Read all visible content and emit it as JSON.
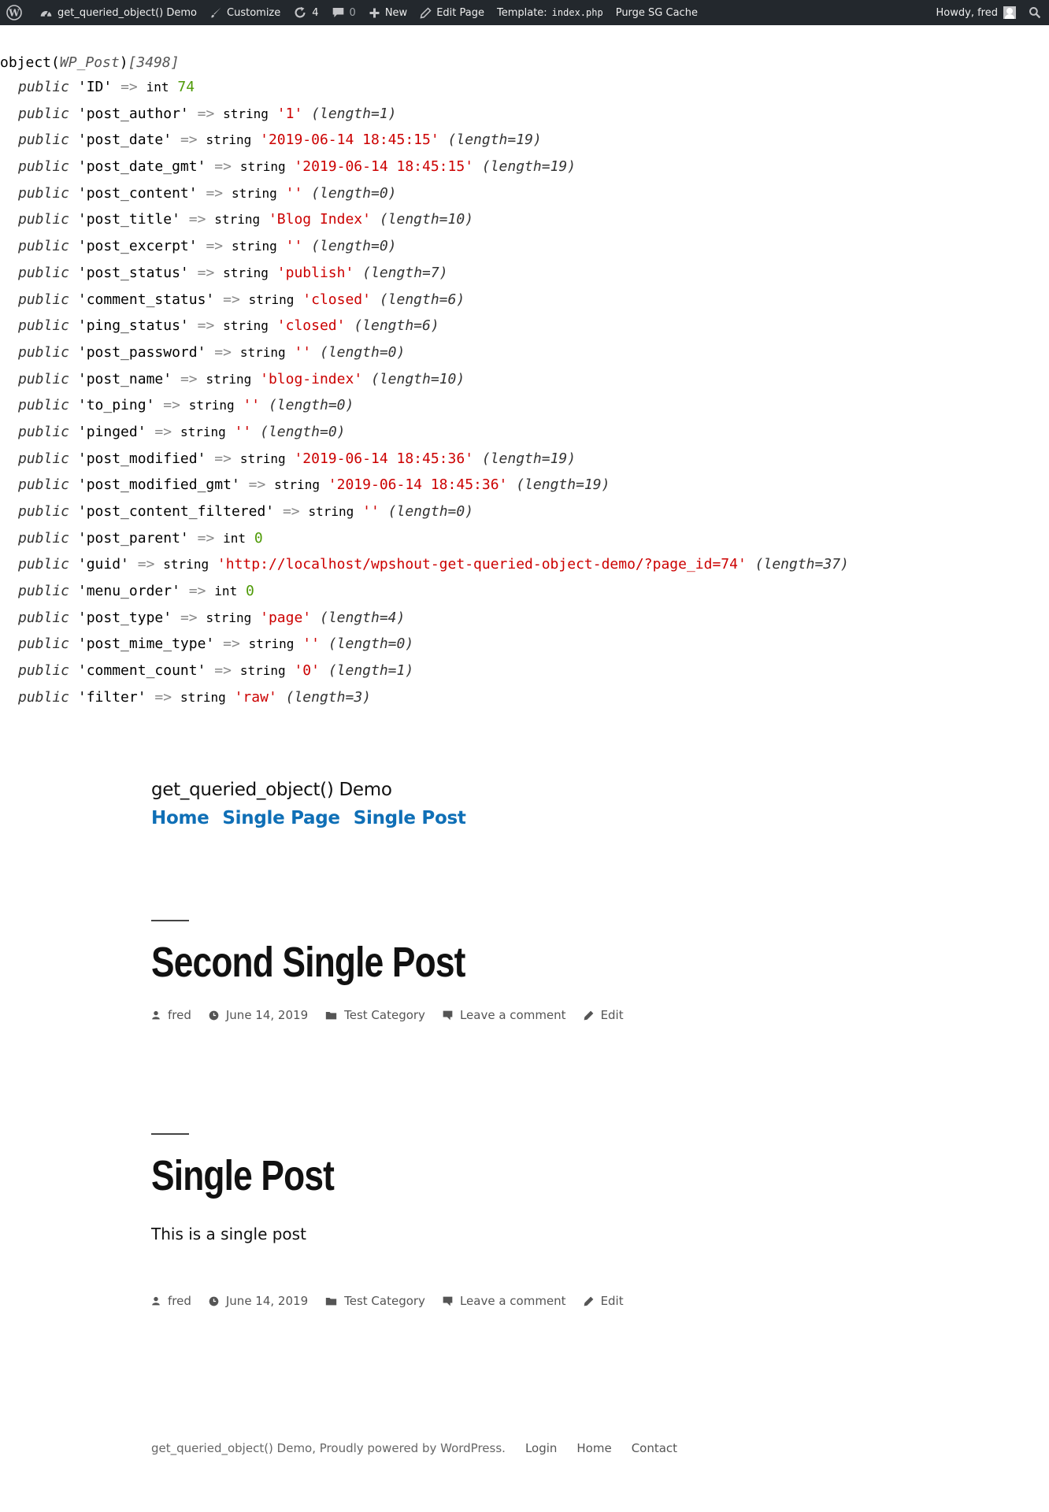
{
  "adminbar": {
    "site_name": "get_queried_object() Demo",
    "customize": "Customize",
    "updates_count": "4",
    "comments_count": "0",
    "new_label": "New",
    "edit_page": "Edit Page",
    "template_label": "Template:",
    "template_file": "index.php",
    "purge_cache": "Purge SG Cache",
    "howdy": "Howdy, fred",
    "colors": {
      "bar_bg": "#23282d",
      "text": "#eeeeee"
    }
  },
  "dump": {
    "object_keyword": "object",
    "class_name": "WP_Post",
    "object_id": "[3498]",
    "properties": [
      {
        "key": "'ID'",
        "type": "int",
        "value": "74",
        "length": ""
      },
      {
        "key": "'post_author'",
        "type": "string",
        "value": "'1'",
        "length": "(length=1)"
      },
      {
        "key": "'post_date'",
        "type": "string",
        "value": "'2019-06-14 18:45:15'",
        "length": "(length=19)"
      },
      {
        "key": "'post_date_gmt'",
        "type": "string",
        "value": "'2019-06-14 18:45:15'",
        "length": "(length=19)"
      },
      {
        "key": "'post_content'",
        "type": "string",
        "value": "''",
        "length": "(length=0)"
      },
      {
        "key": "'post_title'",
        "type": "string",
        "value": "'Blog Index'",
        "length": "(length=10)"
      },
      {
        "key": "'post_excerpt'",
        "type": "string",
        "value": "''",
        "length": "(length=0)"
      },
      {
        "key": "'post_status'",
        "type": "string",
        "value": "'publish'",
        "length": "(length=7)"
      },
      {
        "key": "'comment_status'",
        "type": "string",
        "value": "'closed'",
        "length": "(length=6)"
      },
      {
        "key": "'ping_status'",
        "type": "string",
        "value": "'closed'",
        "length": "(length=6)"
      },
      {
        "key": "'post_password'",
        "type": "string",
        "value": "''",
        "length": "(length=0)"
      },
      {
        "key": "'post_name'",
        "type": "string",
        "value": "'blog-index'",
        "length": "(length=10)"
      },
      {
        "key": "'to_ping'",
        "type": "string",
        "value": "''",
        "length": "(length=0)"
      },
      {
        "key": "'pinged'",
        "type": "string",
        "value": "''",
        "length": "(length=0)"
      },
      {
        "key": "'post_modified'",
        "type": "string",
        "value": "'2019-06-14 18:45:36'",
        "length": "(length=19)"
      },
      {
        "key": "'post_modified_gmt'",
        "type": "string",
        "value": "'2019-06-14 18:45:36'",
        "length": "(length=19)"
      },
      {
        "key": "'post_content_filtered'",
        "type": "string",
        "value": "''",
        "length": "(length=0)"
      },
      {
        "key": "'post_parent'",
        "type": "int",
        "value": "0",
        "length": ""
      },
      {
        "key": "'guid'",
        "type": "string",
        "value": "'http://localhost/wpshout-get-queried-object-demo/?page_id=74'",
        "length": "(length=37)"
      },
      {
        "key": "'menu_order'",
        "type": "int",
        "value": "0",
        "length": ""
      },
      {
        "key": "'post_type'",
        "type": "string",
        "value": "'page'",
        "length": "(length=4)"
      },
      {
        "key": "'post_mime_type'",
        "type": "string",
        "value": "''",
        "length": "(length=0)"
      },
      {
        "key": "'comment_count'",
        "type": "string",
        "value": "'0'",
        "length": "(length=1)"
      },
      {
        "key": "'filter'",
        "type": "string",
        "value": "'raw'",
        "length": "(length=3)"
      }
    ],
    "colors": {
      "string": "#cc0000",
      "int": "#4e9a06"
    }
  },
  "site": {
    "title": "get_queried_object() Demo",
    "nav": [
      "Home",
      "Single Page",
      "Single Post"
    ],
    "link_color": "#0f6fb6"
  },
  "posts": [
    {
      "title": "Second Single Post",
      "excerpt": "",
      "meta": {
        "author": "fred",
        "date": "June 14, 2019",
        "category": "Test Category",
        "comments": "Leave a comment",
        "edit": "Edit"
      }
    },
    {
      "title": "Single Post",
      "excerpt": "This is a single post",
      "meta": {
        "author": "fred",
        "date": "June 14, 2019",
        "category": "Test Category",
        "comments": "Leave a comment",
        "edit": "Edit"
      }
    }
  ],
  "footer": {
    "credit": "get_queried_object() Demo, Proudly powered by WordPress.",
    "links": [
      "Login",
      "Home",
      "Contact"
    ]
  }
}
